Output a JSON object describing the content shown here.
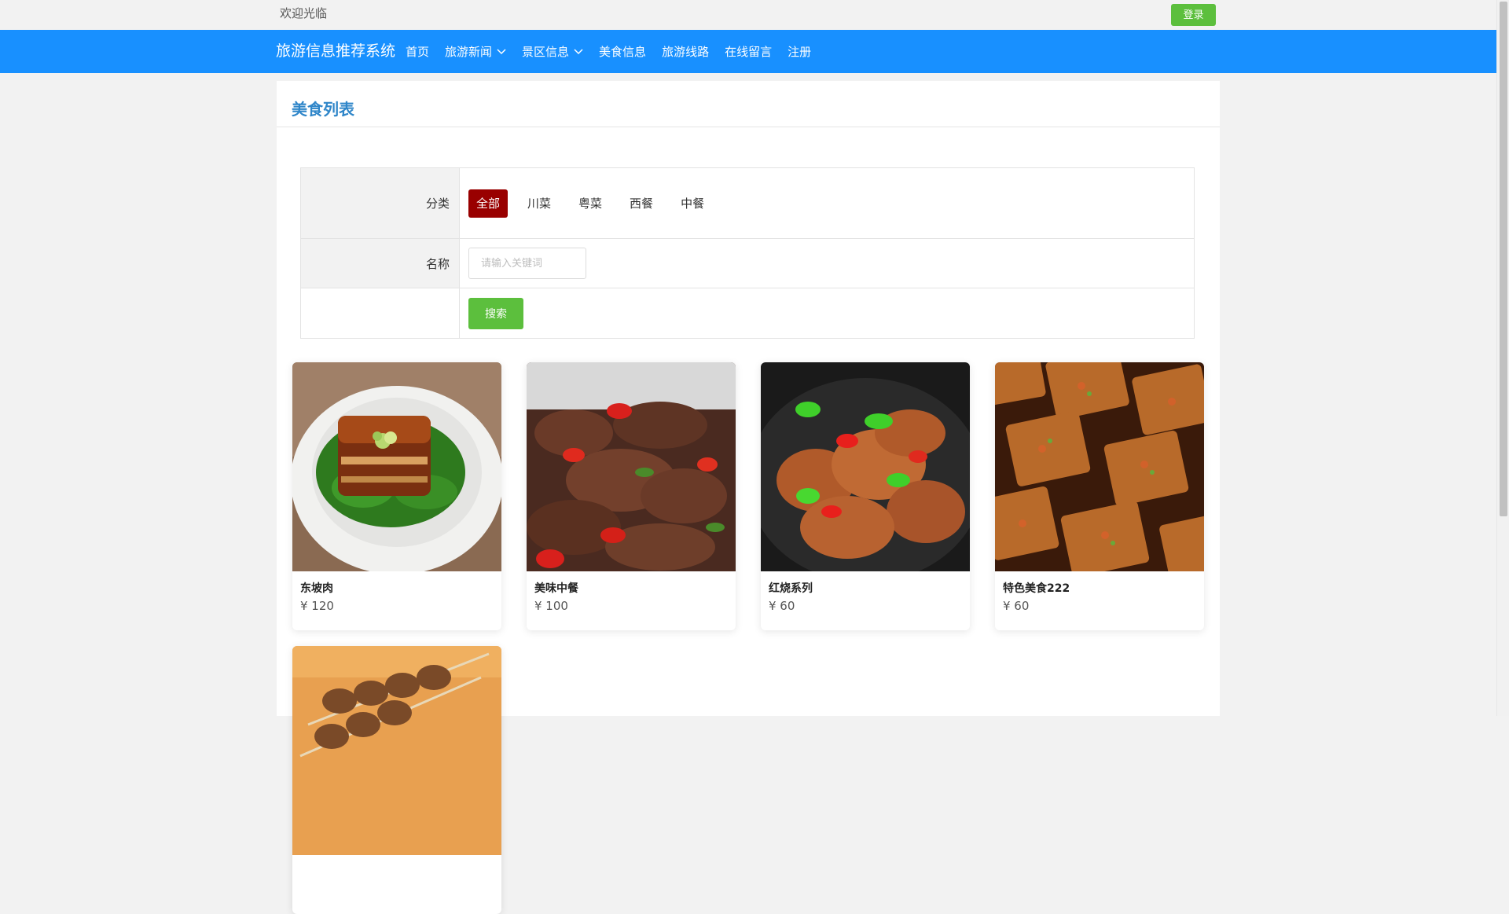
{
  "topbar": {
    "welcome": "欢迎光临",
    "login_label": "登录"
  },
  "navbar": {
    "brand": "旅游信息推荐系统",
    "items": [
      {
        "label": "首页",
        "dropdown": false
      },
      {
        "label": "旅游新闻",
        "dropdown": true
      },
      {
        "label": "景区信息",
        "dropdown": true
      },
      {
        "label": "美食信息",
        "dropdown": false
      },
      {
        "label": "旅游线路",
        "dropdown": false
      },
      {
        "label": "在线留言",
        "dropdown": false
      },
      {
        "label": "注册",
        "dropdown": false
      }
    ]
  },
  "panel": {
    "title": "美食列表"
  },
  "filter": {
    "category_label": "分类",
    "categories": [
      "全部",
      "川菜",
      "粤菜",
      "西餐",
      "中餐"
    ],
    "active_category": "全部",
    "name_label": "名称",
    "name_placeholder": "请输入关键词",
    "name_value": "",
    "search_label": "搜索"
  },
  "foods": [
    {
      "name": "东坡肉",
      "price": "¥ 120",
      "image": "braised-pork-photo"
    },
    {
      "name": "美味中餐",
      "price": "¥ 100",
      "image": "stir-fried-beef-photo"
    },
    {
      "name": "红烧系列",
      "price": "¥ 60",
      "image": "braised-intestine-photo"
    },
    {
      "name": "特色美食222",
      "price": "¥ 60",
      "image": "grilled-tofu-photo"
    },
    {
      "name": "",
      "price": "",
      "image": "meat-skewers-photo"
    }
  ],
  "colors": {
    "nav_bg": "#1890ff",
    "accent_green": "#5cbf3d",
    "active_category": "#990000",
    "title_blue": "#2f86c9"
  }
}
